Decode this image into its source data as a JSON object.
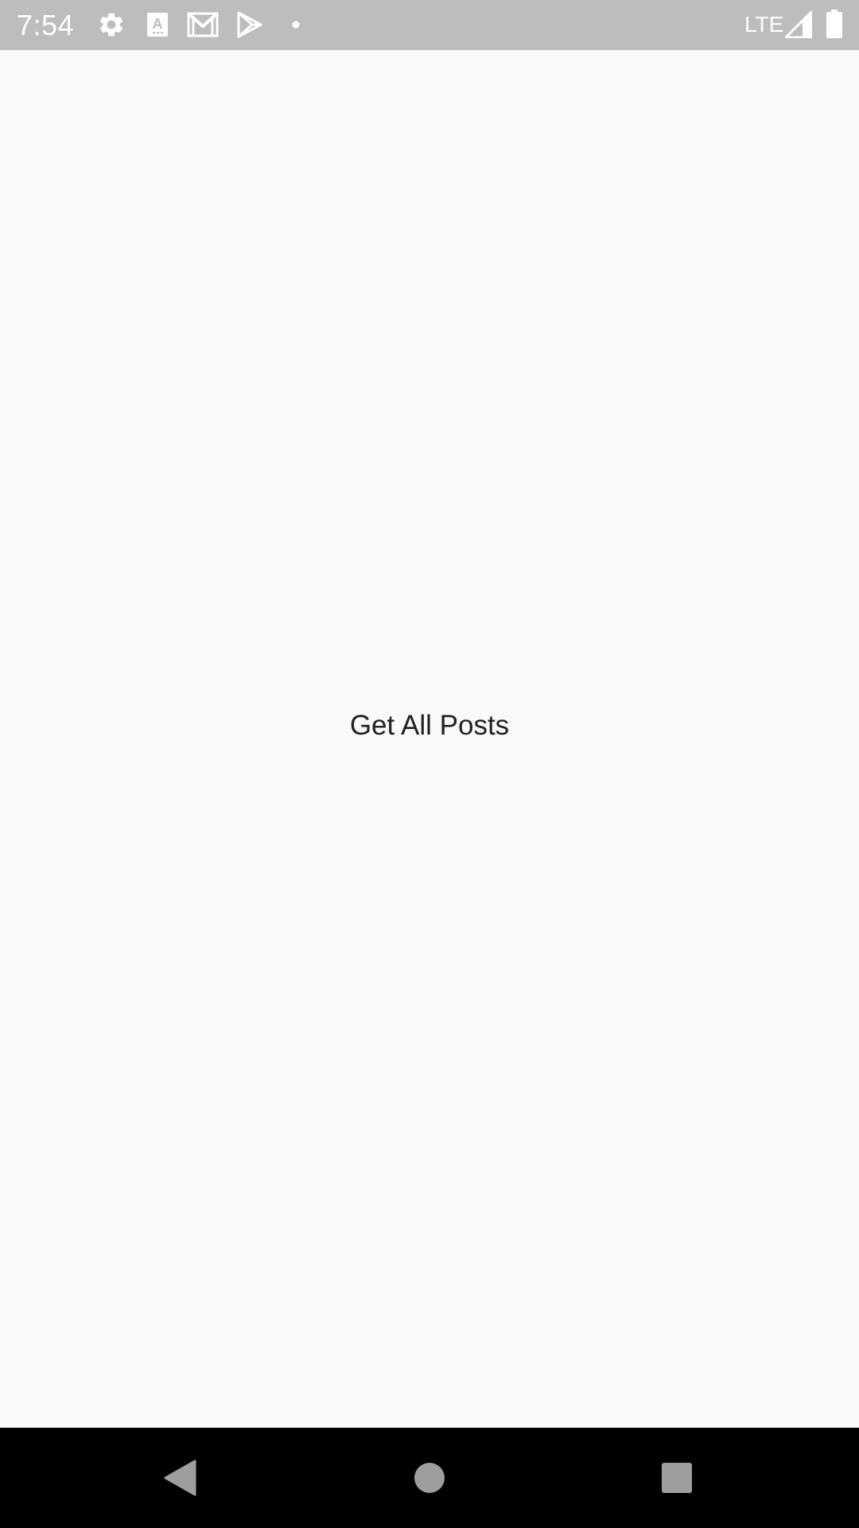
{
  "status_bar": {
    "time": "7:54",
    "network_label": "LTE",
    "icons": [
      "settings-icon",
      "font-icon",
      "gmail-icon",
      "play-store-icon",
      "notification-dot-icon",
      "signal-icon",
      "battery-icon"
    ]
  },
  "main": {
    "button_label": "Get All Posts"
  },
  "nav_bar": {
    "icons": [
      "back-icon",
      "home-icon",
      "recents-icon"
    ]
  },
  "colors": {
    "status_bar_bg": "#bdbdbd",
    "page_bg": "#fafafa",
    "nav_bar_bg": "#000000",
    "button_text": "#212121",
    "nav_icon": "#9e9e9e"
  }
}
